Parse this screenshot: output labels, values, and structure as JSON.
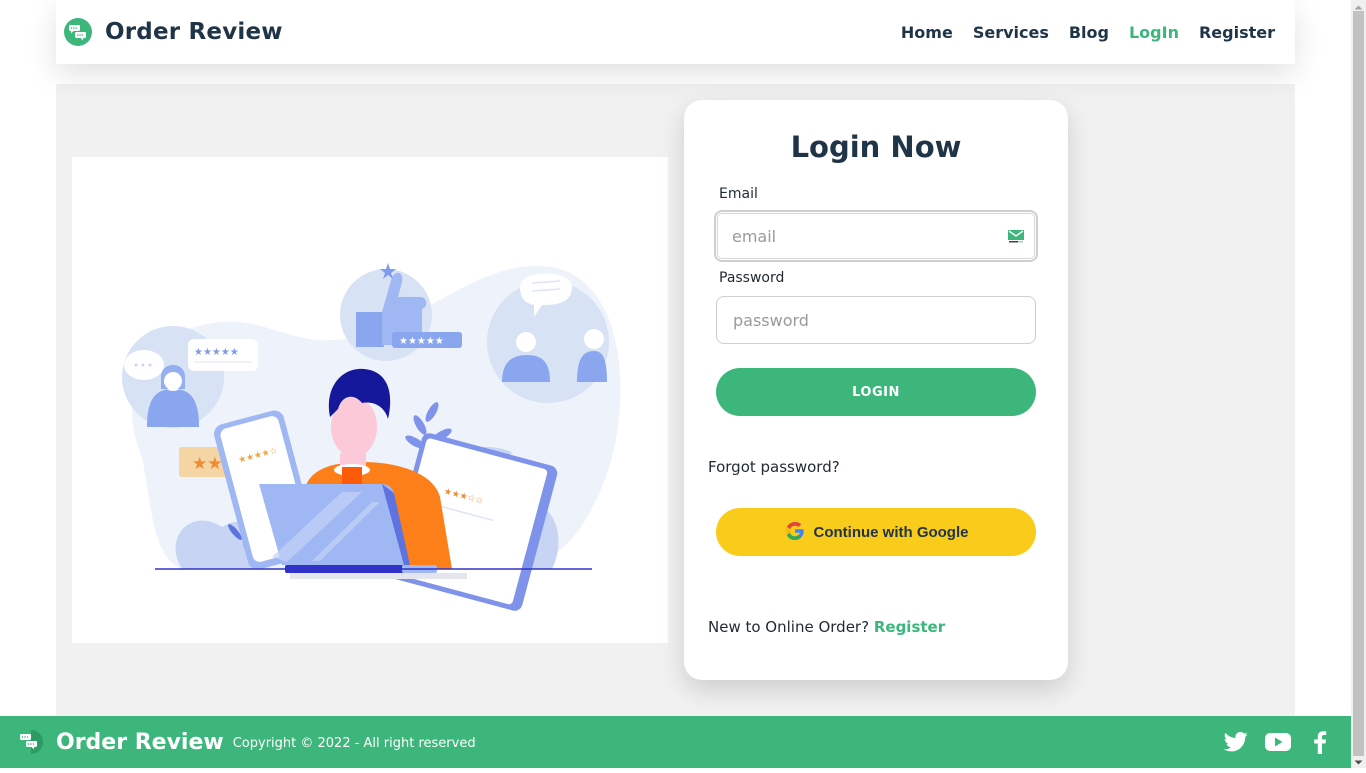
{
  "header": {
    "brand": "Order Review",
    "nav": [
      {
        "label": "Home",
        "active": false
      },
      {
        "label": "Services",
        "active": false
      },
      {
        "label": "Blog",
        "active": false
      },
      {
        "label": "LogIn",
        "active": true
      },
      {
        "label": "Register",
        "active": false
      }
    ]
  },
  "illustration": {
    "alt": "person reviewing ratings on a laptop",
    "icon": "review-illustration"
  },
  "login": {
    "title": "Login Now",
    "email_label": "Email",
    "email_placeholder": "email",
    "email_value": "",
    "password_label": "Password",
    "password_placeholder": "password",
    "password_value": "",
    "login_button": "LOGIN",
    "forgot": "Forgot password?",
    "google_button": "Continue with Google",
    "register_prompt": "New to Online Order?",
    "register_link": "Register"
  },
  "footer": {
    "brand": "Order Review",
    "copyright": "Copyright © 2022 - All right reserved",
    "socials": [
      "twitter",
      "youtube",
      "facebook"
    ]
  },
  "colors": {
    "accent": "#3cb67b",
    "google_button": "#f9cb1b",
    "text_dark": "#1f3447",
    "background": "#f1f1f1"
  }
}
